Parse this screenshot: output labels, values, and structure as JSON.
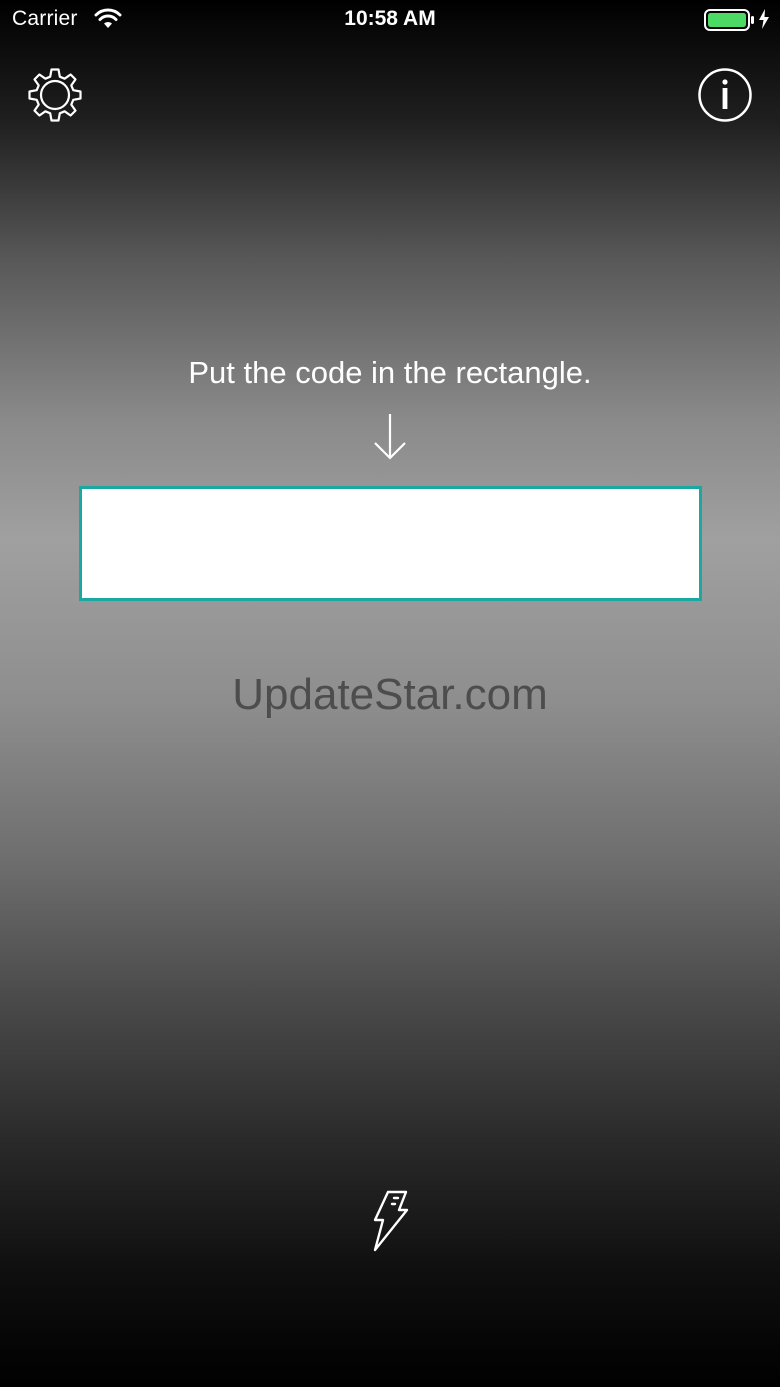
{
  "status_bar": {
    "carrier": "Carrier",
    "time": "10:58 AM",
    "battery_color": "#4cd964"
  },
  "scanner": {
    "instruction": "Put the code in the rectangle.",
    "rect_border_color": "#1aa8a0"
  },
  "watermark": {
    "text": "UpdateStar.com"
  },
  "icons": {
    "settings": "gear-icon",
    "info": "info-icon",
    "arrow": "arrow-down-icon",
    "flash": "lightning-bolt-icon"
  }
}
